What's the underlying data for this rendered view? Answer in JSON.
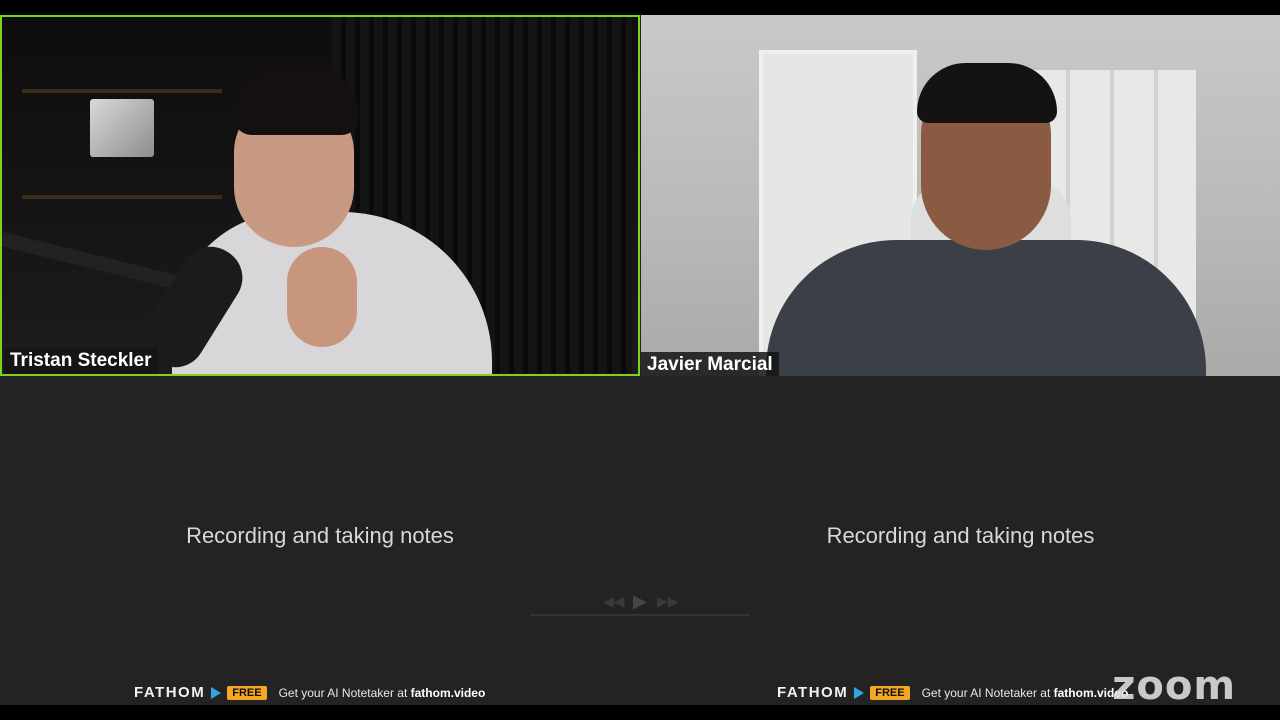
{
  "participants": [
    {
      "name": "Tristan Steckler",
      "active_speaker": true,
      "status": "Recording and taking notes"
    },
    {
      "name": "Javier Marcial",
      "active_speaker": false,
      "status": "Recording and taking notes"
    }
  ],
  "fathom": {
    "brand": "FATHOM",
    "badge": "FREE",
    "promo_prefix": "Get your AI Notetaker at ",
    "promo_link": "fathom.video"
  },
  "branding": {
    "watermark": "zoom"
  },
  "colors": {
    "active_border": "#7ed321",
    "free_badge": "#f5a623",
    "fathom_arrow": "#2fa7e2",
    "background": "#232323"
  },
  "icons": {
    "play": "play-icon",
    "rewind": "rewind-icon",
    "fast_forward": "fast-forward-icon"
  }
}
